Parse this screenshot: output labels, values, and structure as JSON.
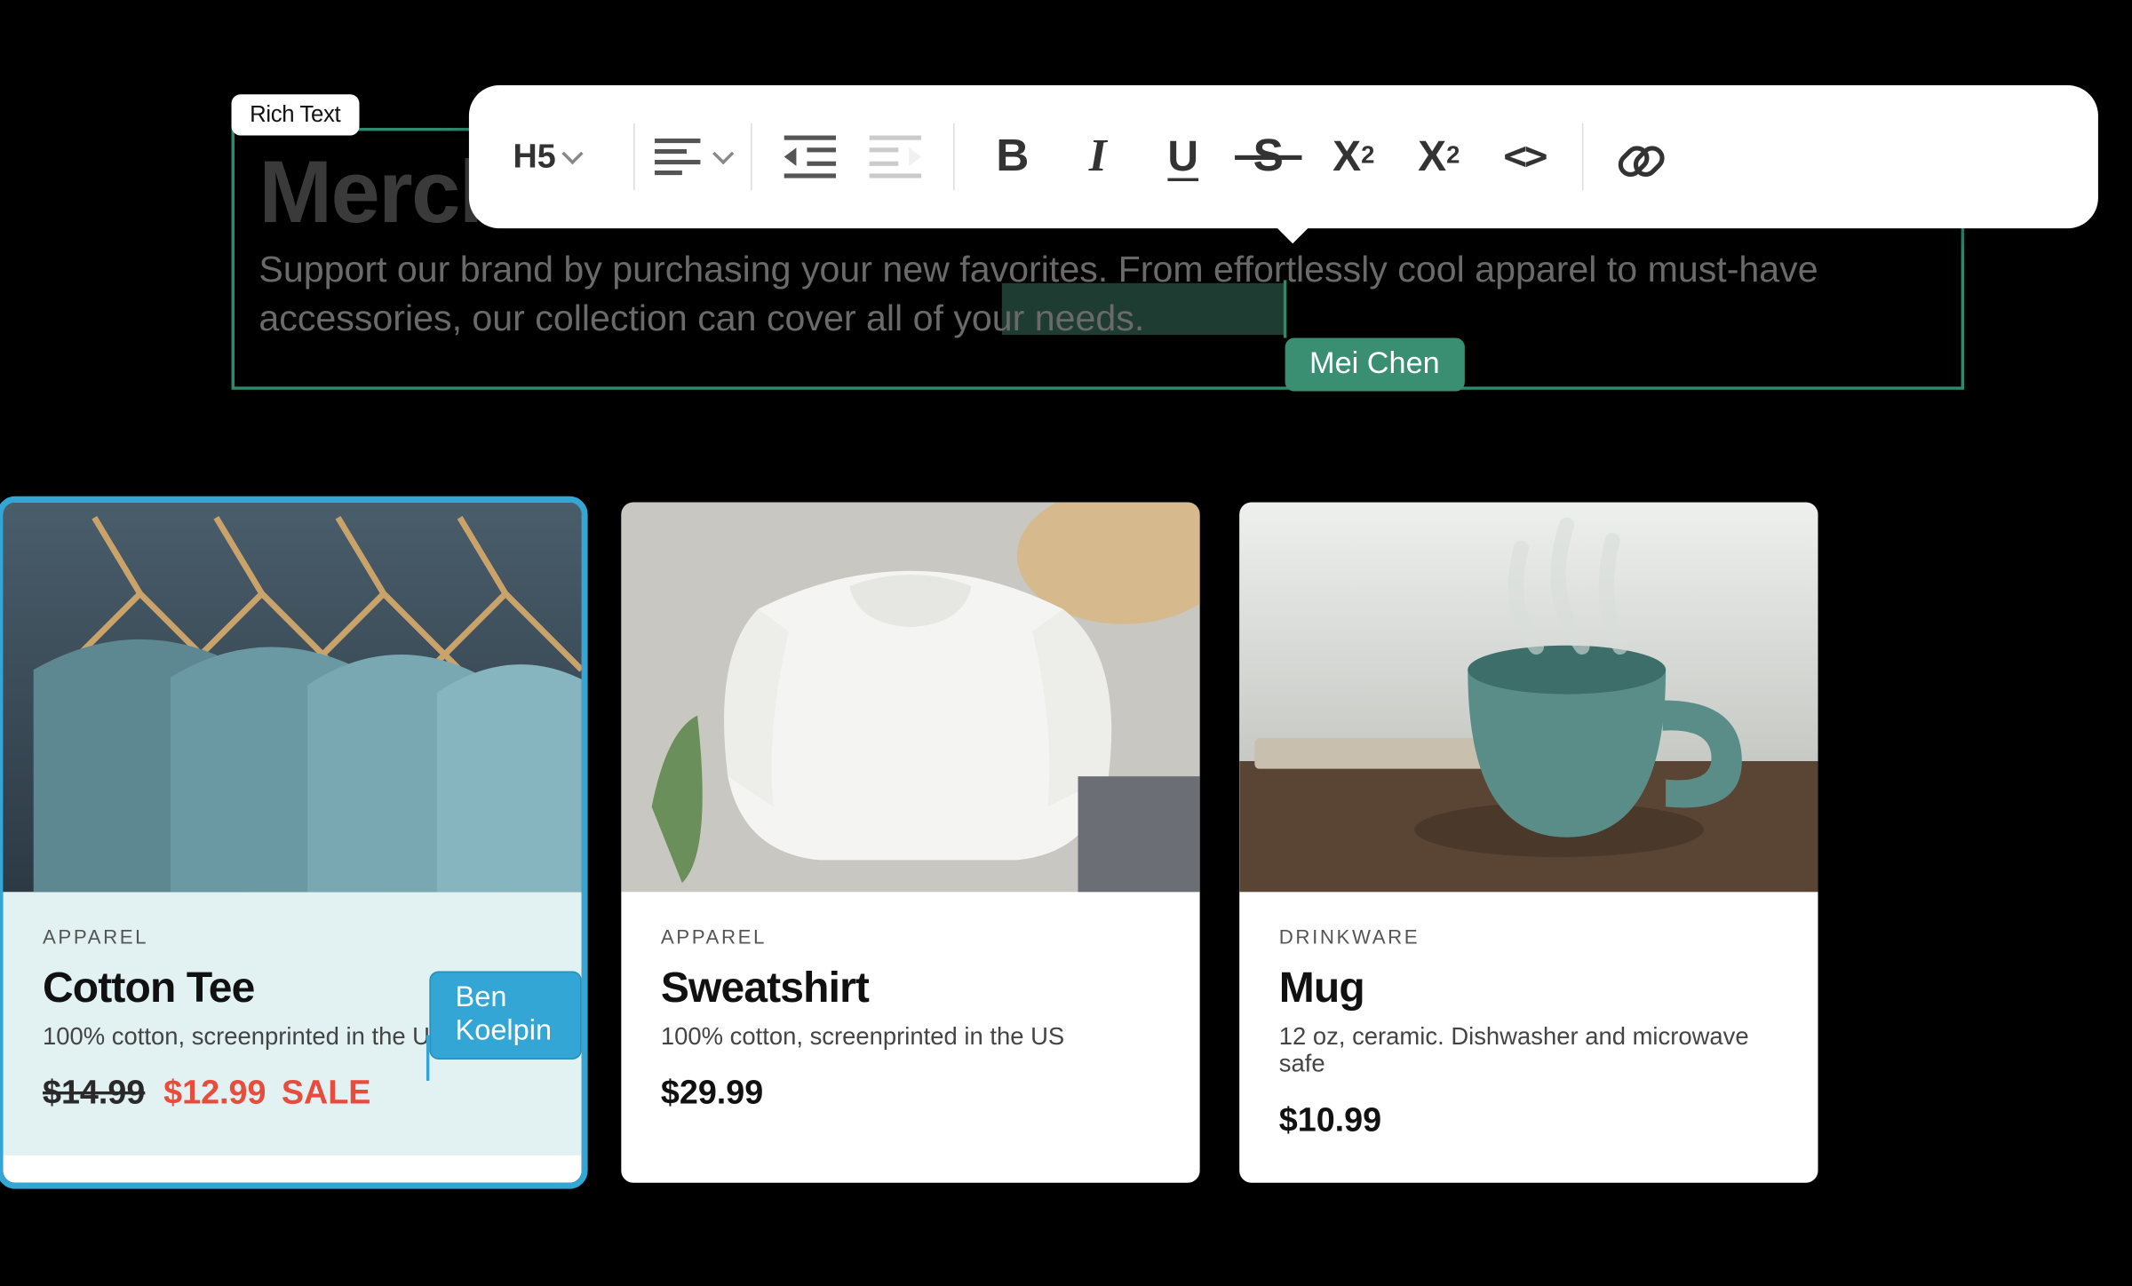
{
  "block_label": "Rich Text",
  "heading": "Merch",
  "subheading": "Support our brand by purchasing your new favorites. From effortlessly cool apparel to must-have accessories, our collection can cover all of your needs.",
  "collaborators": {
    "green": "Mei Chen",
    "blue": "Ben Koelpin"
  },
  "toolbar": {
    "heading_level": "H5"
  },
  "products": [
    {
      "category": "APPAREL",
      "title": "Cotton Tee",
      "desc": "100% cotton, screenprinted in the US",
      "price_old": "$14.99",
      "price_sale": "$12.99",
      "sale_label": "SALE"
    },
    {
      "category": "APPAREL",
      "title": "Sweatshirt",
      "desc": "100% cotton, screenprinted in the US",
      "price": "$29.99"
    },
    {
      "category": "DRINKWARE",
      "title": "Mug",
      "desc": "12 oz, ceramic. Dishwasher and microwave safe",
      "price": "$10.99"
    }
  ]
}
